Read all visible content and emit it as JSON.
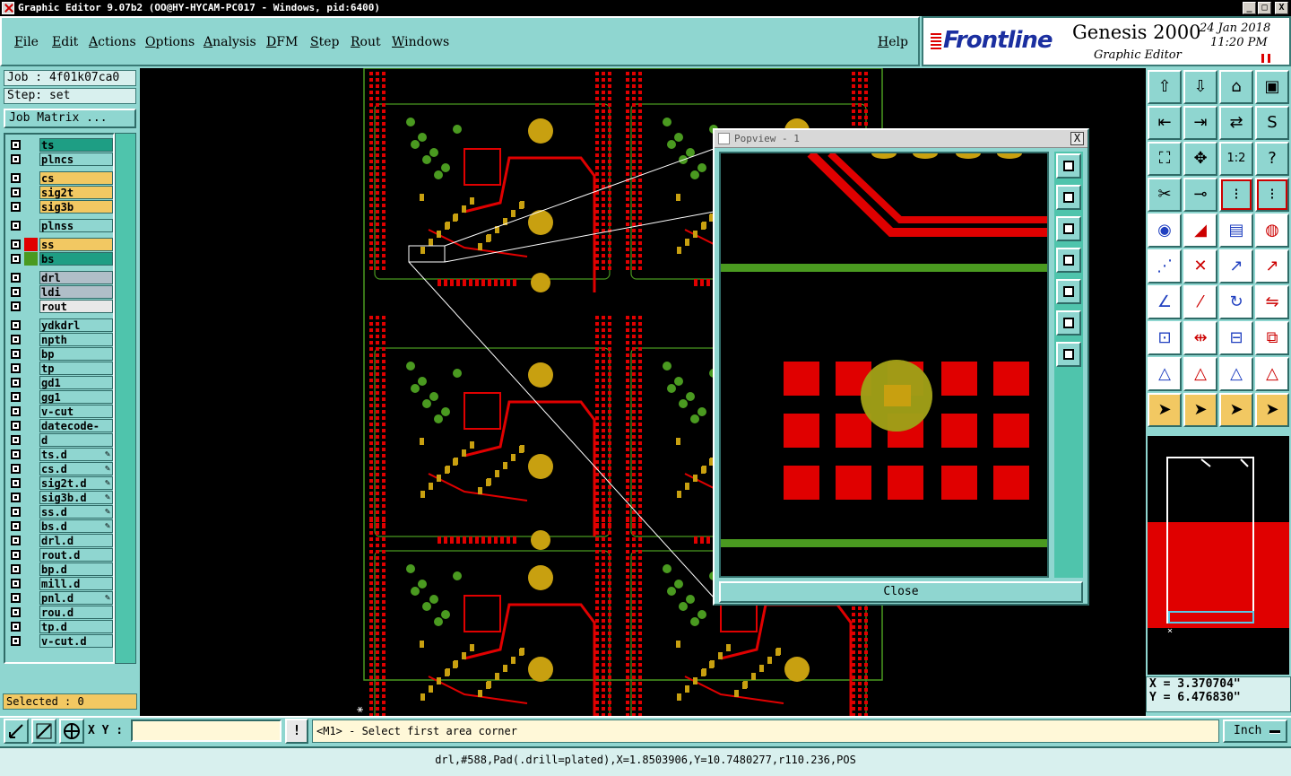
{
  "window": {
    "title": "Graphic Editor 9.07b2 (OO@HY-HYCAM-PC017 - Windows, pid:6400)",
    "minimize": "_",
    "maximize": "□",
    "close": "X"
  },
  "menu": [
    "File",
    "Edit",
    "Actions",
    "Options",
    "Analysis",
    "DFM",
    "Step",
    "Rout",
    "Windows"
  ],
  "help": "Help",
  "brand": {
    "logo_text": "Frontline",
    "product": "Genesis 2000",
    "subtitle": "Graphic Editor",
    "date": "24 Jan 2018",
    "time": "11:20 PM"
  },
  "job": {
    "job_label": "Job : 4f01k07ca0",
    "step_label": "Step: set",
    "matrix_button": "Job Matrix ..."
  },
  "layers": [
    {
      "name": "ts",
      "color": "#1e9e84",
      "swatch": "",
      "edit": false
    },
    {
      "name": "plncs",
      "color": "#8fd6d0",
      "swatch": "",
      "edit": false
    },
    {
      "name": "cs",
      "color": "#f2c862",
      "swatch": "",
      "edit": false
    },
    {
      "name": "sig2t",
      "color": "#f2c862",
      "swatch": "",
      "edit": false
    },
    {
      "name": "sig3b",
      "color": "#f2c862",
      "swatch": "",
      "edit": false
    },
    {
      "name": "plnss",
      "color": "#8fd6d0",
      "swatch": "",
      "edit": false
    },
    {
      "name": "ss",
      "color": "#f2c862",
      "swatch": "#e00000",
      "edit": false
    },
    {
      "name": "bs",
      "color": "#1e9e84",
      "swatch": "#4a9a20",
      "edit": false
    },
    {
      "name": "drl",
      "color": "#b0bec8",
      "swatch": "",
      "edit": false
    },
    {
      "name": "ldi",
      "color": "#b0bec8",
      "swatch": "",
      "edit": false
    },
    {
      "name": "rout",
      "color": "#e8e8e8",
      "swatch": "",
      "edit": false
    },
    {
      "name": "ydkdrl",
      "color": "#8fd6d0",
      "swatch": "",
      "edit": false
    },
    {
      "name": "npth",
      "color": "#8fd6d0",
      "swatch": "",
      "edit": false
    },
    {
      "name": "bp",
      "color": "#8fd6d0",
      "swatch": "",
      "edit": false
    },
    {
      "name": "tp",
      "color": "#8fd6d0",
      "swatch": "",
      "edit": false
    },
    {
      "name": "gd1",
      "color": "#8fd6d0",
      "swatch": "",
      "edit": false
    },
    {
      "name": "gg1",
      "color": "#8fd6d0",
      "swatch": "",
      "edit": false
    },
    {
      "name": "v-cut",
      "color": "#8fd6d0",
      "swatch": "",
      "edit": false
    },
    {
      "name": "datecode-cs",
      "color": "#8fd6d0",
      "swatch": "",
      "edit": false
    },
    {
      "name": "d",
      "color": "#8fd6d0",
      "swatch": "",
      "edit": false
    },
    {
      "name": "ts.d",
      "color": "#8fd6d0",
      "swatch": "",
      "edit": true
    },
    {
      "name": "cs.d",
      "color": "#8fd6d0",
      "swatch": "",
      "edit": true
    },
    {
      "name": "sig2t.d",
      "color": "#8fd6d0",
      "swatch": "",
      "edit": true
    },
    {
      "name": "sig3b.d",
      "color": "#8fd6d0",
      "swatch": "",
      "edit": true
    },
    {
      "name": "ss.d",
      "color": "#8fd6d0",
      "swatch": "",
      "edit": true
    },
    {
      "name": "bs.d",
      "color": "#8fd6d0",
      "swatch": "",
      "edit": true
    },
    {
      "name": "drl.d",
      "color": "#8fd6d0",
      "swatch": "",
      "edit": false
    },
    {
      "name": "rout.d",
      "color": "#8fd6d0",
      "swatch": "",
      "edit": false
    },
    {
      "name": "bp.d",
      "color": "#8fd6d0",
      "swatch": "",
      "edit": false
    },
    {
      "name": "mill.d",
      "color": "#8fd6d0",
      "swatch": "",
      "edit": false
    },
    {
      "name": "pnl.d",
      "color": "#8fd6d0",
      "swatch": "",
      "edit": true
    },
    {
      "name": "rou.d",
      "color": "#8fd6d0",
      "swatch": "",
      "edit": false
    },
    {
      "name": "tp.d",
      "color": "#8fd6d0",
      "swatch": "",
      "edit": false
    },
    {
      "name": "v-cut.d",
      "color": "#8fd6d0",
      "swatch": "",
      "edit": false
    }
  ],
  "selected": "Selected : 0",
  "popview": {
    "title": "Popview - 1",
    "close_x": "X",
    "close_button": "Close"
  },
  "coords": {
    "x": "X = 3.370704\"",
    "y": "Y = 6.476830\""
  },
  "bottom": {
    "xy_label": "X Y :",
    "xy_value": "",
    "warn": "!",
    "prompt": "<M1> - Select first area corner",
    "units": "Inch"
  },
  "status": "drl,#588,Pad(.drill=plated),X=1.8503906,Y=10.7480277,r110.236,POS",
  "colors": {
    "panel": "#8fd6d0",
    "copper_red": "#e00000",
    "trace_green": "#4a9a20",
    "pad_gold": "#c8a010"
  },
  "tool_icons": [
    "home-up-icon",
    "home-down-icon",
    "house-icon",
    "window-icon",
    "arrow-left-icon",
    "arrow-right-icon",
    "swap-icon",
    "s-curve-icon",
    "zoom-fit-icon",
    "zoom-center-icon",
    "ratio-icon",
    "help-icon",
    "measure-icon",
    "probe-icon",
    "net-icon",
    "net-alt-icon",
    "select-pad-icon",
    "draw-line-icon",
    "ruler-icon",
    "circle-pad-icon",
    "connect-icon",
    "cross-icon",
    "move-pad-icon",
    "pad-arrow-icon",
    "angle-icon",
    "diagonal-icon",
    "rotate-icon",
    "mirror-icon",
    "pad-select-icon",
    "split-icon",
    "shrink-icon",
    "copy-icon",
    "triangle-icon",
    "triangle-a-icon",
    "triangle-fill-icon",
    "triangle-off-icon",
    "pointer-icon",
    "pointer-box-icon",
    "pointer-sel-icon",
    "pointer-net-icon"
  ]
}
